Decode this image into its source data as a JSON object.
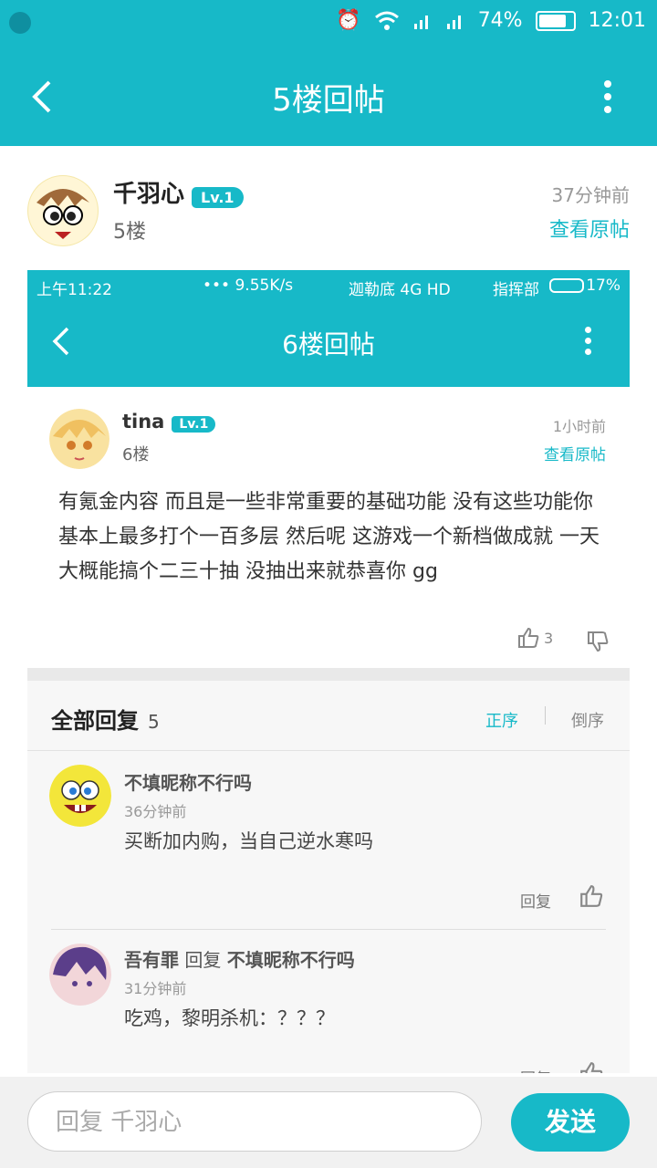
{
  "status_bar": {
    "battery": "74%",
    "time": "12:01"
  },
  "app_bar": {
    "title": "5楼回帖"
  },
  "post": {
    "username": "千羽心",
    "level": "Lv.1",
    "floor": "5楼",
    "time": "37分钟前",
    "view_original": "查看原帖"
  },
  "embedded": {
    "status_bar": {
      "left_time": "上午11:22",
      "speed": "••• 9.55K/s",
      "carrier1": "迦勒底 4G HD",
      "carrier2": "指挥部",
      "battery": "17%"
    },
    "app_bar": {
      "title": "6楼回帖"
    },
    "post": {
      "username": "tina",
      "level": "Lv.1",
      "floor": "6楼",
      "time": "1小时前",
      "view_original": "查看原帖",
      "content": "有氪金内容 而且是一些非常重要的基础功能 没有这些功能你基本上最多打个一百多层 然后呢 这游戏一个新档做成就 一天大概能搞个二三十抽 没抽出来就恭喜你 gg",
      "likes": "3"
    },
    "replies_header": {
      "title": "全部回复",
      "count": "5",
      "sort_asc": "正序",
      "sort_desc": "倒序"
    },
    "replies": [
      {
        "username": "不填昵称不行吗",
        "time": "36分钟前",
        "text": "买断加内购，当自己逆水寒吗",
        "reply_label": "回复"
      },
      {
        "username": "吾有罪",
        "reply_word": "回复",
        "reply_to": "不填昵称不行吗",
        "time": "31分钟前",
        "text": "吃鸡，黎明杀机：？？？",
        "reply_label": "回复"
      }
    ]
  },
  "reply_bar": {
    "placeholder": "回复 千羽心",
    "send_label": "发送"
  },
  "colors": {
    "accent": "#17b9c8"
  }
}
